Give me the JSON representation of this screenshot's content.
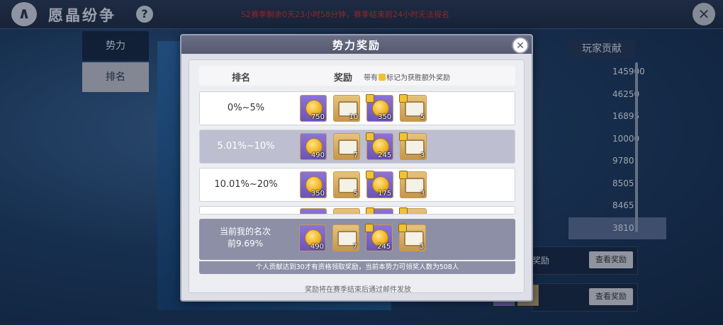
{
  "topbar": {
    "title": "愿晶纷争",
    "help_label": "?",
    "notice": "S2赛季剩余0天23小时58分钟，赛季结束前24小时无法报名",
    "close_label": "✕"
  },
  "left_tabs": [
    {
      "label": "势力",
      "active": false
    },
    {
      "label": "排名",
      "active": true
    }
  ],
  "contribution": {
    "header": "玩家贡献",
    "values": [
      "145900",
      "46250",
      "16895",
      "10000",
      "9780",
      "8505",
      "8465",
      "3810"
    ]
  },
  "reward_boxes": [
    {
      "label": "奖励",
      "button": "查看奖励"
    },
    {
      "label": "",
      "button": "查看奖励"
    }
  ],
  "modal": {
    "title": "势力奖励",
    "close_label": "✕",
    "header": {
      "rank": "排名",
      "reward": "奖励",
      "note_prefix": "带有",
      "note_suffix": "标记为获胜额外奖励"
    },
    "rows": [
      {
        "range": "0%~5%",
        "items": [
          {
            "kind": "coin",
            "qty": "750",
            "bonus": false
          },
          {
            "kind": "chest",
            "qty": "10",
            "bonus": false
          },
          {
            "kind": "coin",
            "qty": "350",
            "bonus": true
          },
          {
            "kind": "chest",
            "qty": "5",
            "bonus": true
          }
        ]
      },
      {
        "range": "5.01%~10%",
        "items": [
          {
            "kind": "coin",
            "qty": "490",
            "bonus": false
          },
          {
            "kind": "chest",
            "qty": "7",
            "bonus": false
          },
          {
            "kind": "coin",
            "qty": "245",
            "bonus": true
          },
          {
            "kind": "chest",
            "qty": "3",
            "bonus": true
          }
        ]
      },
      {
        "range": "10.01%~20%",
        "items": [
          {
            "kind": "coin",
            "qty": "350",
            "bonus": false
          },
          {
            "kind": "chest",
            "qty": "5",
            "bonus": false
          },
          {
            "kind": "coin",
            "qty": "175",
            "bonus": true
          },
          {
            "kind": "chest",
            "qty": "3",
            "bonus": true
          }
        ]
      }
    ],
    "my_rank": {
      "line1": "当前我的名次",
      "line2": "前9.69%",
      "items": [
        {
          "kind": "coin",
          "qty": "490",
          "bonus": false
        },
        {
          "kind": "chest",
          "qty": "7",
          "bonus": false
        },
        {
          "kind": "coin",
          "qty": "245",
          "bonus": true
        },
        {
          "kind": "chest",
          "qty": "3",
          "bonus": true
        }
      ]
    },
    "personal_note": "个人贡献达到30才有资格领取奖励，当前本势力可领奖人数为508人",
    "mail_note": "奖励将在赛季结束后通过邮件发放"
  }
}
